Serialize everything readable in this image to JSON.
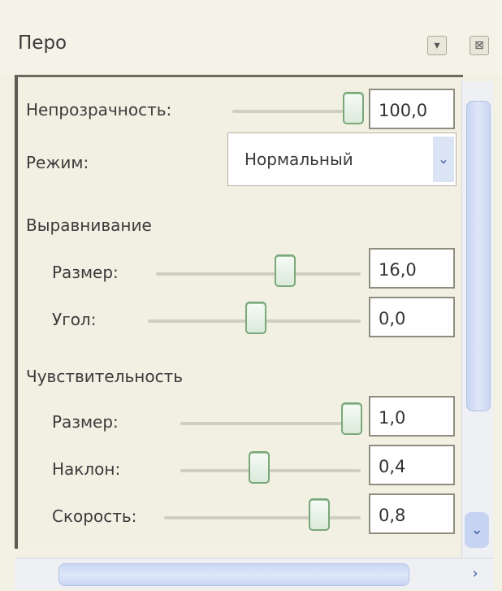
{
  "window": {
    "title": "Перо"
  },
  "titlebar": {
    "pin_icon": "pin-icon",
    "close_icon": "close-icon",
    "pin_glyph": "▾",
    "close_glyph": "⊠"
  },
  "opacity": {
    "label": "Непрозрачность:",
    "value": "100,0",
    "level": 1.0
  },
  "mode": {
    "label": "Режим:",
    "selected": "Нормальный",
    "arrow": "⌄"
  },
  "alignment": {
    "heading": "Выравнивание",
    "size": {
      "label": "Размер:",
      "value": "16,0",
      "level": 0.62
    },
    "angle": {
      "label": "Угол:",
      "value": "0,0",
      "level": 0.5
    }
  },
  "sensitivity": {
    "heading": "Чувствительность",
    "size": {
      "label": "Размер:",
      "value": "1,0",
      "level": 1.0
    },
    "tilt": {
      "label": "Наклон:",
      "value": "0,4",
      "level": 0.38
    },
    "speed": {
      "label": "Скорость:",
      "value": "0,8",
      "level": 0.76
    }
  },
  "scrollbars": {
    "down_glyph": "⌄",
    "right_glyph": "›"
  }
}
